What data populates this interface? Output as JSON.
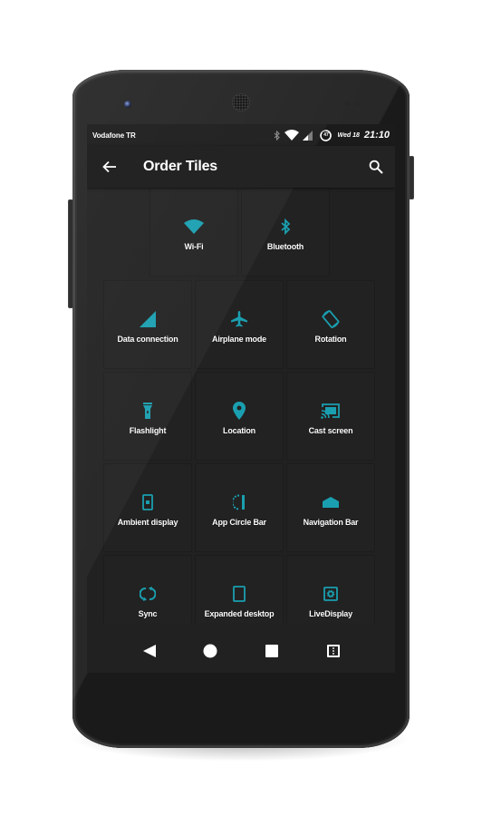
{
  "status_bar": {
    "carrier": "Vodafone TR",
    "battery_level": "47",
    "date": "Wed 18",
    "time": "21:10",
    "icons": [
      "bluetooth-icon",
      "wifi-icon",
      "cell-signal-icon",
      "battery-circle-icon"
    ]
  },
  "app_bar": {
    "title": "Order Tiles",
    "back_icon": "arrow-left-icon",
    "search_icon": "search-icon"
  },
  "accent_color": "#1a9fb0",
  "tiles": [
    {
      "label": "Wi-Fi",
      "icon": "wifi-icon"
    },
    {
      "label": "Bluetooth",
      "icon": "bluetooth-icon"
    },
    {
      "label": "Data connection",
      "icon": "cell-signal-icon"
    },
    {
      "label": "Airplane mode",
      "icon": "airplane-icon"
    },
    {
      "label": "Rotation",
      "icon": "rotation-icon"
    },
    {
      "label": "Flashlight",
      "icon": "flashlight-icon"
    },
    {
      "label": "Location",
      "icon": "location-pin-icon"
    },
    {
      "label": "Cast screen",
      "icon": "cast-icon"
    },
    {
      "label": "Ambient display",
      "icon": "ambient-display-icon"
    },
    {
      "label": "App Circle Bar",
      "icon": "app-circle-bar-icon"
    },
    {
      "label": "Navigation Bar",
      "icon": "navigation-bar-icon"
    },
    {
      "label": "Sync",
      "icon": "sync-icon"
    },
    {
      "label": "Expanded desktop",
      "icon": "expanded-desktop-icon"
    },
    {
      "label": "LiveDisplay",
      "icon": "live-display-icon"
    }
  ],
  "nav_bar": {
    "buttons": [
      "back-triangle-icon",
      "home-circle-icon",
      "recents-square-icon",
      "menu-icon"
    ]
  }
}
